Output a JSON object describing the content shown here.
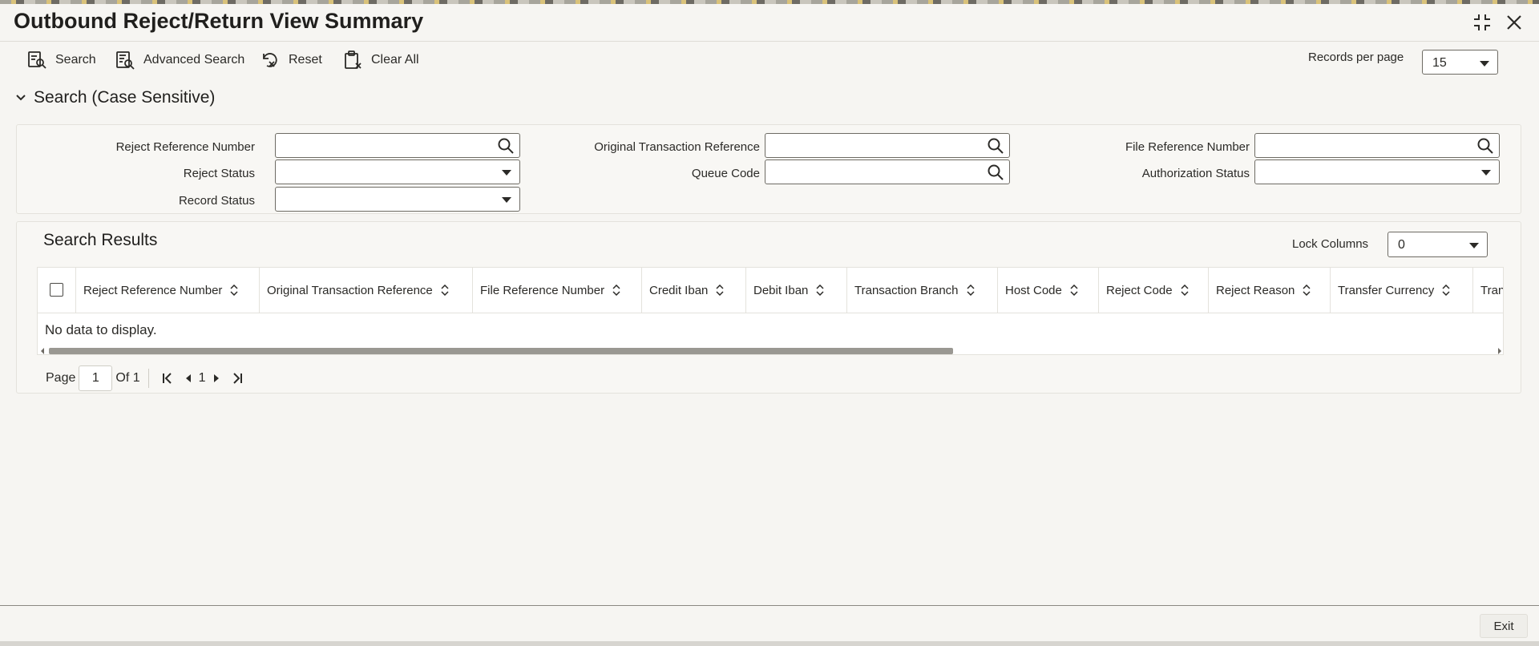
{
  "window": {
    "title": "Outbound Reject/Return View Summary",
    "maximize_icon": "collapse-arrows-icon",
    "close_icon": "close-icon"
  },
  "toolbar": {
    "buttons": [
      {
        "label": "Search",
        "icon": "search-list-icon"
      },
      {
        "label": "Advanced Search",
        "icon": "advanced-search-icon"
      },
      {
        "label": "Reset",
        "icon": "reset-icon"
      },
      {
        "label": "Clear All",
        "icon": "clipboard-clear-icon"
      }
    ],
    "records_per_page_label": "Records per page",
    "records_per_page_value": "15"
  },
  "search_section": {
    "title": "Search (Case Sensitive)",
    "fields": [
      {
        "label": "Reject Reference Number",
        "value": "",
        "type": "lookup"
      },
      {
        "label": "Original Transaction Reference",
        "value": "",
        "type": "lookup"
      },
      {
        "label": "File Reference Number",
        "value": "",
        "type": "lookup"
      },
      {
        "label": "Reject Status",
        "value": "",
        "type": "select"
      },
      {
        "label": "Queue Code",
        "value": "",
        "type": "lookup"
      },
      {
        "label": "Authorization Status",
        "value": "",
        "type": "select"
      },
      {
        "label": "Record Status",
        "value": "",
        "type": "select"
      }
    ]
  },
  "results": {
    "title": "Search Results",
    "lock_columns_label": "Lock Columns",
    "lock_columns_value": "0",
    "columns": [
      "Reject Reference Number",
      "Original Transaction Reference",
      "File Reference Number",
      "Credit Iban",
      "Debit Iban",
      "Transaction Branch",
      "Host Code",
      "Reject Code",
      "Reject Reason",
      "Transfer Currency",
      "Tran"
    ],
    "empty_message": "No data to display.",
    "pager": {
      "page_label": "Page",
      "current_page": "1",
      "of_label": "Of 1",
      "page_number": "1"
    }
  },
  "footer": {
    "exit_label": "Exit"
  },
  "colors": {
    "background": "#f6f5f2",
    "border": "#6e6b64",
    "text": "#2b2a27"
  }
}
